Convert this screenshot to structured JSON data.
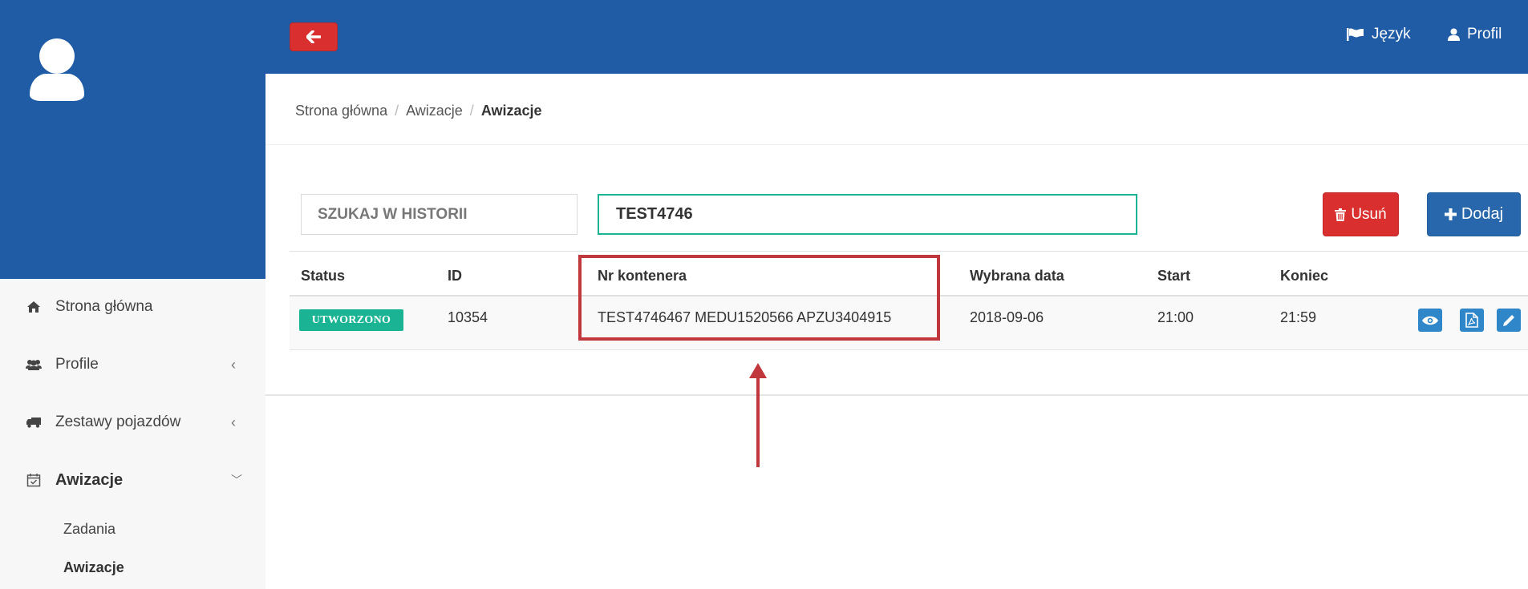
{
  "topbar": {
    "language_label": "Język",
    "profile_label": "Profil"
  },
  "sidebar": {
    "items": [
      {
        "label": "Strona główna",
        "icon": "home-icon"
      },
      {
        "label": "Profile",
        "icon": "users-icon"
      },
      {
        "label": "Zestawy pojazdów",
        "icon": "truck-icon"
      },
      {
        "label": "Awizacje",
        "icon": "calendar-check-icon"
      }
    ],
    "subitems": [
      {
        "label": "Zadania"
      },
      {
        "label": "Awizacje"
      }
    ]
  },
  "breadcrumb": {
    "home": "Strona główna",
    "section": "Awizacje",
    "current": "Awizacje"
  },
  "search": {
    "label": "SZUKAJ W HISTORII",
    "value": "TEST4746"
  },
  "buttons": {
    "delete": "Usuń",
    "add": "Dodaj"
  },
  "table": {
    "headers": [
      "Status",
      "ID",
      "Nr kontenera",
      "Wybrana data",
      "Start",
      "Koniec"
    ],
    "rows": [
      {
        "status": "UTWORZONO",
        "id": "10354",
        "containers": "TEST4746467 MEDU1520566 APZU3404915",
        "date": "2018-09-06",
        "start": "21:00",
        "end": "21:59"
      }
    ]
  },
  "colors": {
    "brand_blue": "#205ca6",
    "danger_red": "#d9302f",
    "success_green": "#1ab394",
    "annotation_red": "#c0373c"
  }
}
